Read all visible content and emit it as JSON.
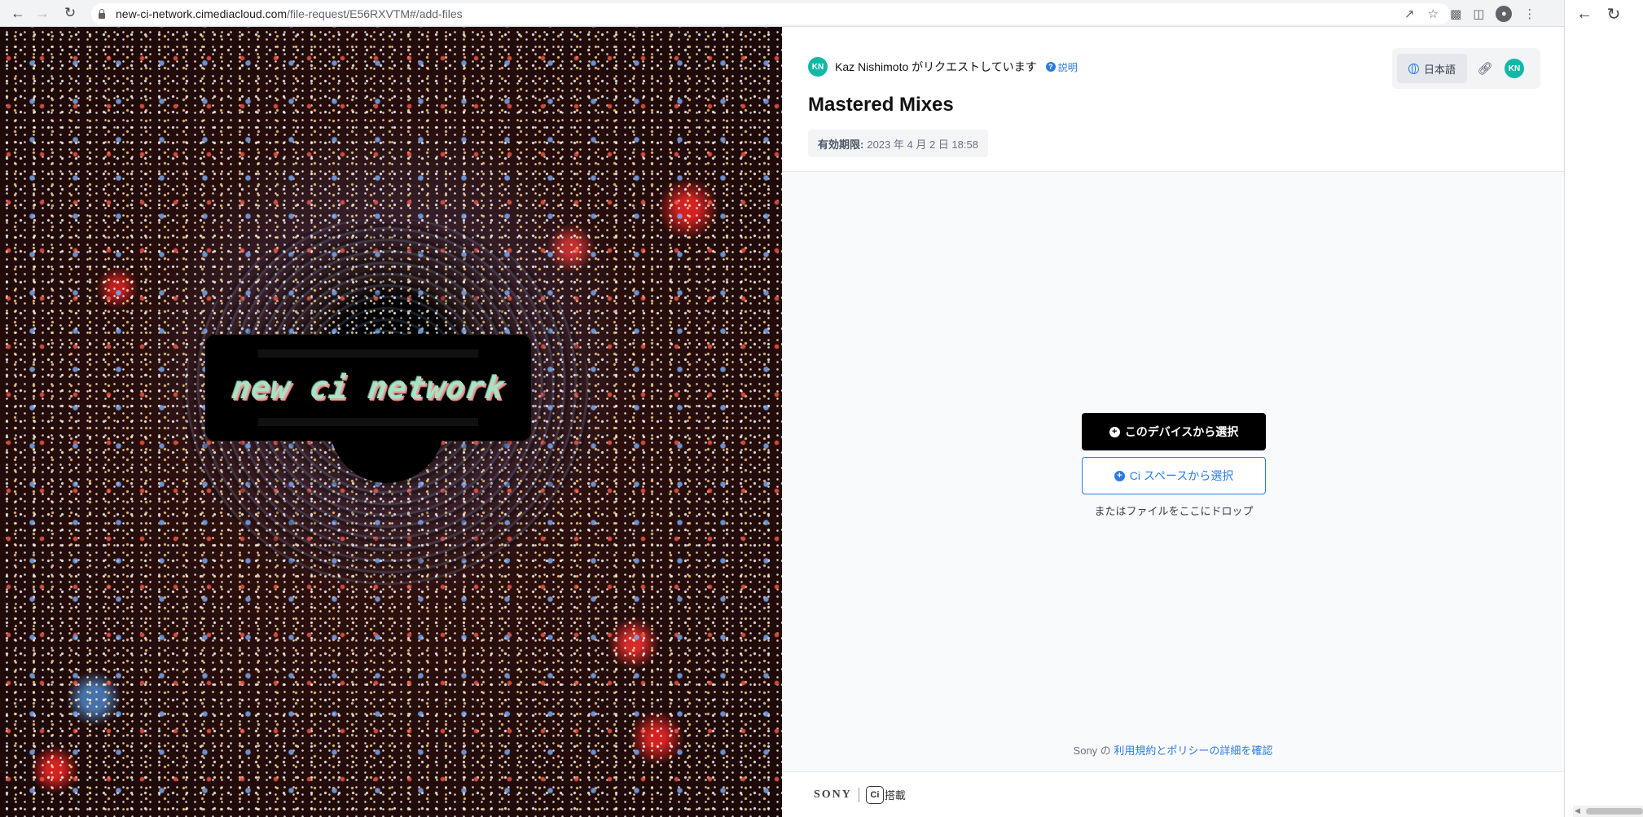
{
  "browser": {
    "url_host": "new-ci-network.cimediacloud.com",
    "url_path": "/file-request/E56RXVTM#/add-files"
  },
  "hero": {
    "logo_text": "new ci network"
  },
  "header": {
    "avatar_initials": "KN",
    "requester_text": "Kaz Nishimoto がリクエストしています",
    "help_label": "説明",
    "title": "Mastered Mixes",
    "expiry_label": "有効期限:",
    "expiry_value": "2023 年 4 月 2 日 18:58"
  },
  "toolbar": {
    "language": "日本語",
    "avatar_initials": "KN"
  },
  "upload": {
    "device_button": "このデバイスから選択",
    "ci_button": "Ci スペースから選択",
    "drop_hint": "またはファイルをここにドロップ"
  },
  "terms": {
    "prefix": "Sony の",
    "link": "利用規約とポリシーの詳細を確認"
  },
  "footer": {
    "brand": "SONY",
    "ci_mark": "Ci",
    "powered_label": "搭載"
  },
  "colors": {
    "accent": "#2d7be5",
    "avatar": "#12b8a6",
    "primary_button": "#000000"
  }
}
